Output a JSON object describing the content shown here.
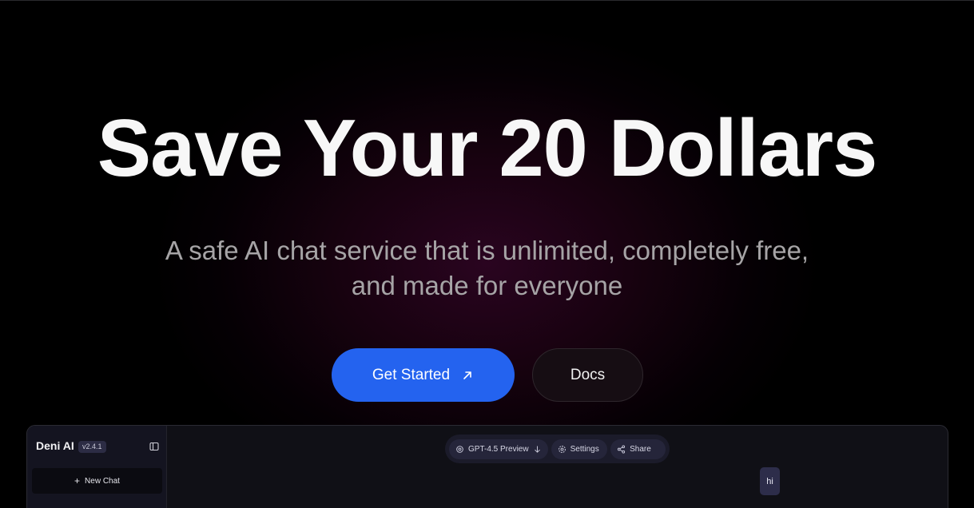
{
  "hero": {
    "title": "Save Your 20 Dollars",
    "subtitle_line1": "A safe AI chat service that is unlimited, completely free,",
    "subtitle_line2": "and made for everyone"
  },
  "cta": {
    "primary_label": "Get Started",
    "primary_icon": "arrow-up-right-icon",
    "secondary_label": "Docs"
  },
  "app_preview": {
    "sidebar": {
      "brand": "Deni AI",
      "version": "v2.4.1",
      "toggle_icon": "sidebar-toggle-icon",
      "new_chat_label": "New Chat",
      "new_chat_icon": "plus-icon"
    },
    "toolbar": {
      "model_label": "GPT-4.5 Preview",
      "model_icon": "openai-icon",
      "settings_label": "Settings",
      "settings_icon": "gear-icon",
      "share_label": "Share",
      "share_icon": "share-icon"
    },
    "messages": [
      {
        "role": "user",
        "text": "hi"
      }
    ]
  },
  "colors": {
    "primary_button": "#2463ef",
    "background": "#000000",
    "glow": "#2a0420",
    "app_panel": "#101016"
  }
}
